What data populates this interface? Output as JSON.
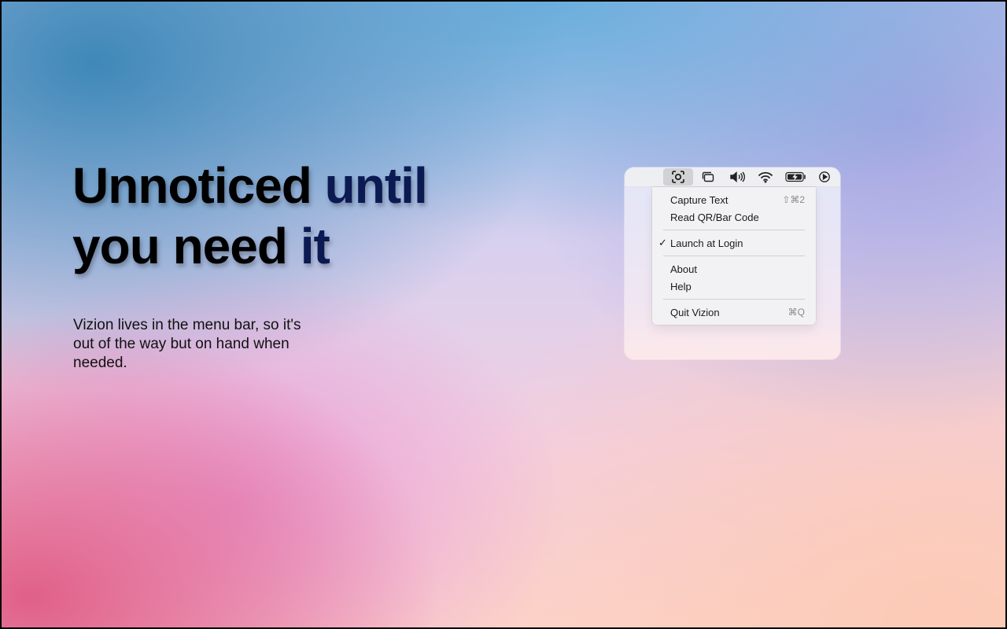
{
  "hero": {
    "headline_line1": "Unnoticed",
    "headline_accent1": "until",
    "headline_line2": "you need",
    "headline_accent2": "it",
    "description": "Vizion lives in the menu bar, so it's out of the way but on hand when needed."
  },
  "menubar": {
    "icons": [
      "text-capture-icon",
      "window-stack-icon",
      "volume-icon",
      "wifi-icon",
      "battery-charging-icon",
      "play-circle-icon"
    ]
  },
  "menu": {
    "capture_text": "Capture Text",
    "capture_text_shortcut": "⇧⌘2",
    "read_code": "Read QR/Bar Code",
    "launch_check": "✓",
    "launch_at_login": "Launch at Login",
    "about": "About",
    "help": "Help",
    "quit": "Quit Vizion",
    "quit_shortcut": "⌘Q"
  },
  "colors": {
    "headline": "#000000",
    "accent": "#0b1a52"
  }
}
